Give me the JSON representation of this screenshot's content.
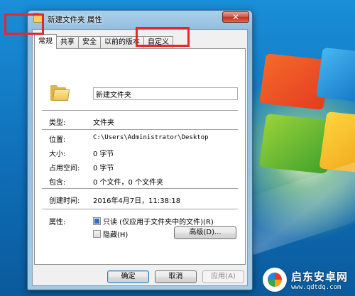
{
  "window": {
    "title": "新建文件夹 属性",
    "close_label": "✕"
  },
  "tabs": [
    {
      "label": "常规",
      "active": true
    },
    {
      "label": "共享"
    },
    {
      "label": "安全"
    },
    {
      "label": "以前的版本"
    },
    {
      "label": "自定义"
    }
  ],
  "general": {
    "folder_name": "新建文件夹",
    "type_label": "类型:",
    "type_value": "文件夹",
    "location_label": "位置:",
    "location_value": "C:\\Users\\Administrator\\Desktop",
    "size_label": "大小:",
    "size_value": "0 字节",
    "disk_size_label": "占用空间:",
    "disk_size_value": "0 字节",
    "contains_label": "包含:",
    "contains_value": "0 个文件，0 个文件夹",
    "created_label": "创建时间:",
    "created_value": "2016年4月7日，11:38:18",
    "attributes_label": "属性:",
    "readonly_label": "只读 (仅应用于文件夹中的文件)(R)",
    "hidden_label": "隐藏(H)",
    "advanced_label": "高级(D)..."
  },
  "footer": {
    "ok_label": "确定",
    "cancel_label": "取消",
    "apply_label": "应用(A)"
  },
  "watermark": {
    "name": "启东安卓网",
    "url": "www.qdtdq.com"
  },
  "colors": {
    "highlight": "#e6262d",
    "desktop": "#1a8ed8"
  }
}
